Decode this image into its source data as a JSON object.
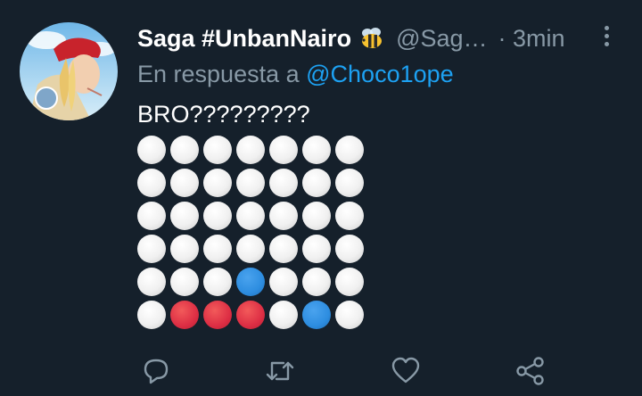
{
  "tweet": {
    "display_name": "Saga #UnbanNairo",
    "name_emoji": "bee-emoji",
    "handle": "@Sag…",
    "time": "· 3min",
    "reply_prefix": "En respuesta a ",
    "reply_mention": "@Choco1ope",
    "text": "BRO?????????"
  },
  "board": {
    "columns": 7,
    "rows": [
      [
        "white",
        "white",
        "white",
        "white",
        "white",
        "white",
        "white"
      ],
      [
        "white",
        "white",
        "white",
        "white",
        "white",
        "white",
        "white"
      ],
      [
        "white",
        "white",
        "white",
        "white",
        "white",
        "white",
        "white"
      ],
      [
        "white",
        "white",
        "white",
        "white",
        "white",
        "white",
        "white"
      ],
      [
        "white",
        "white",
        "white",
        "blue",
        "white",
        "white",
        "white"
      ],
      [
        "white",
        "red",
        "red",
        "red",
        "white",
        "blue",
        "white"
      ]
    ]
  },
  "actions": [
    "reply-icon",
    "retweet-icon",
    "like-icon",
    "share-icon"
  ],
  "colors": {
    "background": "#15202b",
    "secondary_text": "#8899a6",
    "link": "#1da1f2",
    "red_disc": "#dd2e44",
    "blue_disc": "#2d8de0"
  }
}
